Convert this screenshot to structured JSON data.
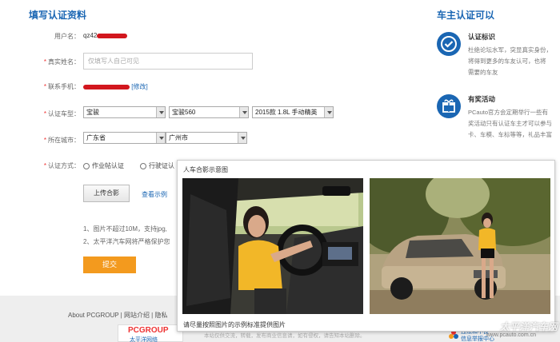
{
  "form": {
    "title": "填写认证资料",
    "username_label": "用户名：",
    "username_value": "qz42",
    "realname_label": "真实姓名：",
    "realname_placeholder": "仅填写人自己可见",
    "phone_label": "联系手机：",
    "phone_edit": "[修改]",
    "car_model_label": "认证车型：",
    "car_brand": "宝骏",
    "car_series": "宝骏560",
    "car_version": "2015款 1.8L 手动精英",
    "city_label": "所在城市：",
    "province": "广东省",
    "city": "广州市",
    "method_label": "认证方式：",
    "method_option1": "作业帖认证",
    "method_option2": "行驶证认",
    "upload_button": "上传合影",
    "view_example": "查看示例",
    "note1": "1、图片不超过10M，支持jpg,",
    "note2": "2、太平洋汽车网将严格保护您",
    "submit_button": "提交"
  },
  "sidebar": {
    "title": "车主认证可以",
    "features": [
      {
        "icon": "certified-badge-icon",
        "title": "认证标识",
        "lines": [
          "杜绝论坛水军，突显真实身份，",
          "将得到更多的车友认可，也将",
          "需要的车友"
        ]
      },
      {
        "icon": "gift-icon",
        "title": "有奖活动",
        "lines": [
          "PCauto官方会定期举行一些有",
          "奖活动只有认证车主才可以参与",
          "卡、车模、车标等等，礼品丰富"
        ]
      }
    ]
  },
  "popup": {
    "title": "人车合影示意图",
    "caption": "请尽量按照图片的示例标准提供图片"
  },
  "footer": {
    "links": "About PCGROUP | 网站介绍 | 隐私",
    "logo_text": "PCGROUP",
    "logo_sub": "太平洋网络",
    "blurb": "本站仅供交流，转载，发布商业信息请，如有侵权，请告知本站删除。",
    "right_text1": "违法和不良",
    "right_text2": "信息举报中心"
  },
  "watermark": {
    "cn": "太平洋汽车网",
    "url": "www.pcauto.com.cn"
  },
  "colors": {
    "accent": "#1a66b3",
    "submit": "#f39a1e",
    "required": "#ee3333",
    "redaction": "#d2171e"
  }
}
